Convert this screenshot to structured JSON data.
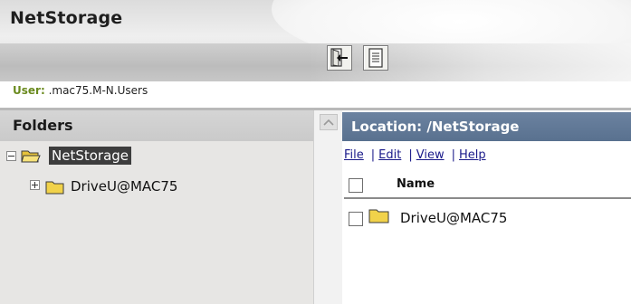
{
  "app": {
    "title": "NetStorage"
  },
  "toolbar": {
    "logout_icon": "logout-icon",
    "document_icon": "document-icon"
  },
  "user": {
    "label": "User:",
    "value": ".mac75.M-N.Users"
  },
  "folders": {
    "title": "Folders",
    "tree": [
      {
        "label": "NetStorage",
        "expanded": true,
        "selected": true,
        "icon": "open-folder-icon"
      },
      {
        "label": "DriveU@MAC75",
        "expanded": false,
        "selected": false,
        "icon": "folder-icon"
      }
    ]
  },
  "location": {
    "label": "Location: /NetStorage"
  },
  "menu": {
    "file": "File",
    "sep": "|",
    "edit": "Edit",
    "view": "View",
    "help": "Help"
  },
  "table": {
    "column_name": "Name",
    "rows": [
      {
        "name": "DriveU@MAC75",
        "icon": "folder-icon",
        "checked": false
      }
    ]
  },
  "colors": {
    "location_bar": "#5f7794",
    "link": "#1a1a8a",
    "user_label": "#6a8a1e",
    "selected_bg": "#3d3d3d"
  }
}
